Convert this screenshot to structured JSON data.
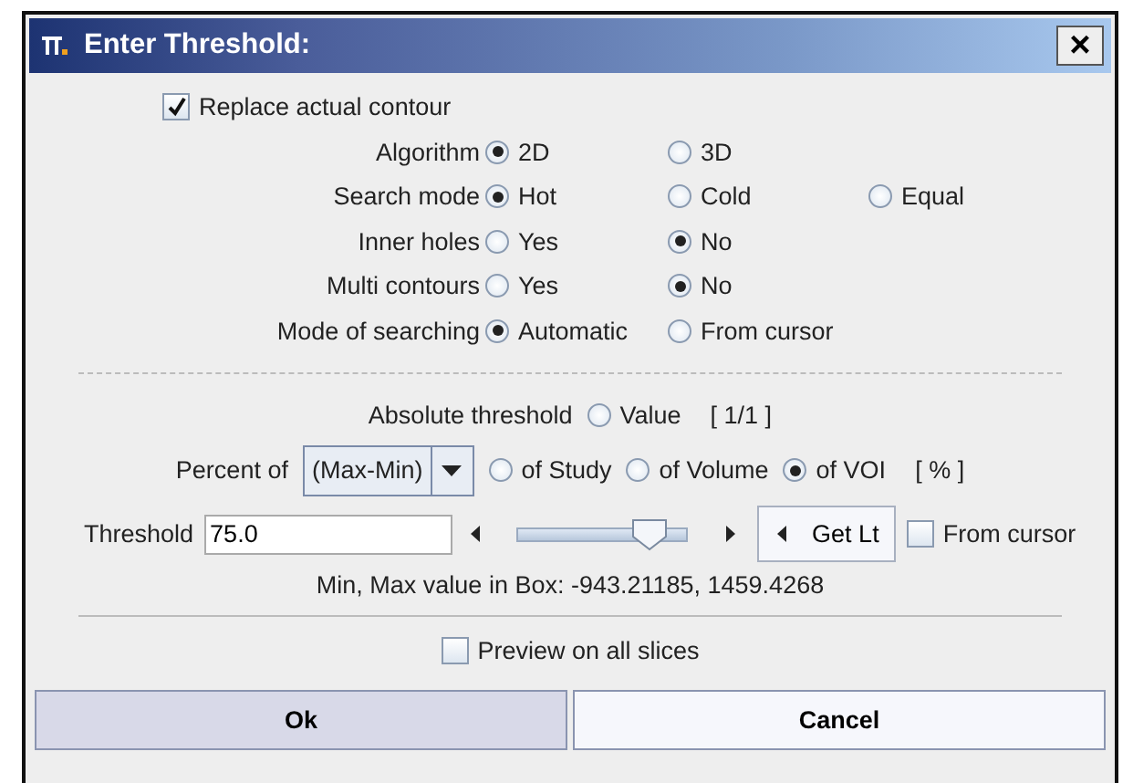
{
  "window": {
    "title": "Enter Threshold:",
    "close": "×"
  },
  "replace_contour": {
    "label": "Replace actual contour",
    "checked": true
  },
  "option_rows": [
    {
      "label": "Algorithm",
      "options": [
        {
          "label": "2D",
          "selected": true
        },
        {
          "label": "3D",
          "selected": false
        }
      ]
    },
    {
      "label": "Search mode",
      "options": [
        {
          "label": "Hot",
          "selected": true
        },
        {
          "label": "Cold",
          "selected": false
        },
        {
          "label": "Equal",
          "selected": false
        }
      ]
    },
    {
      "label": "Inner holes",
      "options": [
        {
          "label": "Yes",
          "selected": false
        },
        {
          "label": "No",
          "selected": true
        }
      ]
    },
    {
      "label": "Multi contours",
      "options": [
        {
          "label": "Yes",
          "selected": false
        },
        {
          "label": "No",
          "selected": true
        }
      ]
    },
    {
      "label": "Mode of searching",
      "options": [
        {
          "label": "Automatic",
          "selected": true
        },
        {
          "label": "From cursor",
          "selected": false
        }
      ]
    }
  ],
  "absolute": {
    "label": "Absolute threshold",
    "options": [
      {
        "label": "Value",
        "selected": false
      }
    ],
    "unit": "[ 1/1 ]"
  },
  "percent": {
    "label": "Percent of",
    "dropdown": "(Max-Min)",
    "options": [
      {
        "label": "of Study",
        "selected": false
      },
      {
        "label": "of Volume",
        "selected": false
      },
      {
        "label": "of VOI",
        "selected": true
      }
    ],
    "unit": "[ % ]"
  },
  "threshold": {
    "label": "Threshold",
    "value": "75.0",
    "level": 0.78,
    "get_button": "Get Lt",
    "from_cursor": {
      "label": "From cursor",
      "checked": false
    }
  },
  "info": "Min, Max value in Box: -943.21185, 1459.4268",
  "preview": {
    "label": "Preview on all slices",
    "checked": false
  },
  "buttons": [
    {
      "label": "Ok",
      "hovered": true
    },
    {
      "label": "Cancel",
      "hovered": false
    }
  ]
}
